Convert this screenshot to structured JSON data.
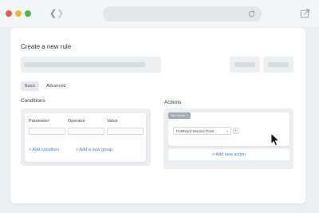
{
  "browser": {
    "back_icon": "chevron-left-icon",
    "forward_icon": "chevron-right-icon",
    "reload_icon": "reload-icon",
    "share_icon": "share-icon",
    "colors": {
      "close": "#e45a4f",
      "minimize": "#e8b93a",
      "maximize": "#52b548"
    }
  },
  "page": {
    "title": "Create a new rule",
    "tabs": [
      {
        "label": "Basic",
        "selected": true
      },
      {
        "label": "Advanced",
        "selected": false
      }
    ],
    "conditions": {
      "label": "Conditions",
      "columns": [
        "Parameter",
        "Operator",
        "Value"
      ],
      "add_condition": "+ Add condition",
      "add_group": "+ Add a new group"
    },
    "actions": {
      "label": "Actions",
      "chip": "Set carrier",
      "chip_icon": "close-icon",
      "service_select": "PostNord Service Point",
      "plus_label": "+",
      "add_action": "+ Add new action"
    },
    "accent_color": "#3f7fd6"
  }
}
